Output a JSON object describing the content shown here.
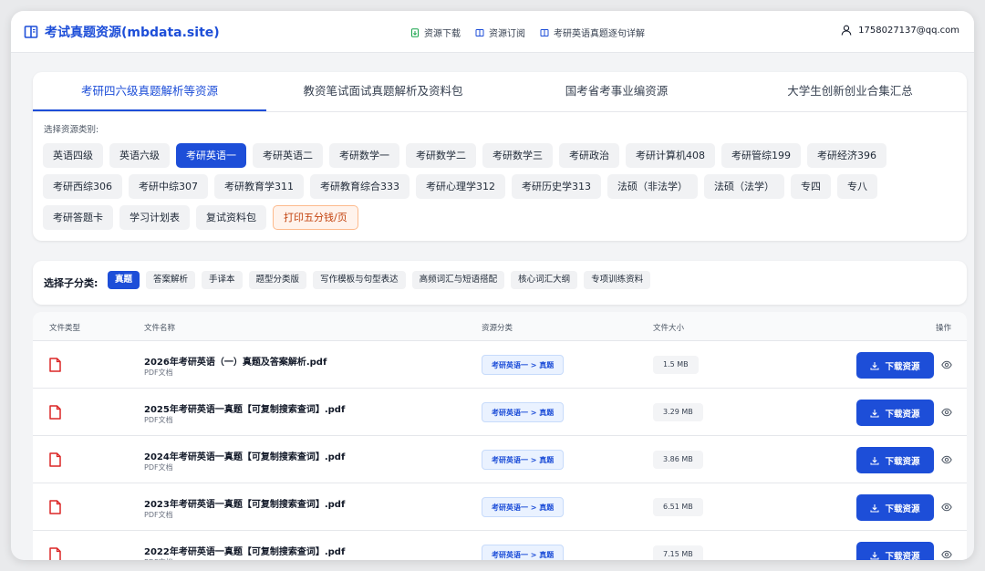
{
  "header": {
    "title": "考试真题资源(mbdata.site)",
    "nav": [
      {
        "label": "资源下载",
        "icon": "download-file-icon"
      },
      {
        "label": "资源订阅",
        "icon": "book-icon"
      },
      {
        "label": "考研英语真题逐句详解",
        "icon": "book-icon"
      }
    ],
    "user_email": "1758027137@qq.com"
  },
  "tabs": [
    {
      "label": "考研四六级真题解析等资源",
      "active": true
    },
    {
      "label": "教资笔试面试真题解析及资料包",
      "active": false
    },
    {
      "label": "国考省考事业编资源",
      "active": false
    },
    {
      "label": "大学生创新创业合集汇总",
      "active": false
    }
  ],
  "category_label": "选择资源类别:",
  "categories": [
    "英语四级",
    "英语六级",
    "考研英语一",
    "考研英语二",
    "考研数学一",
    "考研数学二",
    "考研数学三",
    "考研政治",
    "考研计算机408",
    "考研管综199",
    "考研经济396",
    "考研西综306",
    "考研中综307",
    "考研教育学311",
    "考研教育综合333",
    "考研心理学312",
    "考研历史学313",
    "法硕（非法学）",
    "法硕（法学）",
    "专四",
    "专八",
    "考研答题卡",
    "学习计划表",
    "复试资料包",
    "打印五分钱/页"
  ],
  "active_category": "考研英语一",
  "promo_category": "打印五分钱/页",
  "subcategory_label": "选择子分类:",
  "subcategories": [
    "真题",
    "答案解析",
    "手译本",
    "题型分类版",
    "写作模板与句型表达",
    "高频词汇与短语搭配",
    "核心词汇大纲",
    "专项训练资料"
  ],
  "active_subcategory": "真题",
  "table": {
    "headers": {
      "type": "文件类型",
      "name": "文件名称",
      "category": "资源分类",
      "size": "文件大小",
      "action": "操作"
    },
    "download_label": "下载资源",
    "rows": [
      {
        "name": "2026年考研英语（一）真题及答案解析.pdf",
        "type": "PDF文档",
        "category": "考研英语一 > 真题",
        "size": "1.5 MB"
      },
      {
        "name": "2025年考研英语一真题【可复制搜索查词】.pdf",
        "type": "PDF文档",
        "category": "考研英语一 > 真题",
        "size": "3.29 MB"
      },
      {
        "name": "2024年考研英语一真题【可复制搜索查词】.pdf",
        "type": "PDF文档",
        "category": "考研英语一 > 真题",
        "size": "3.86 MB"
      },
      {
        "name": "2023年考研英语一真题【可复制搜索查词】.pdf",
        "type": "PDF文档",
        "category": "考研英语一 > 真题",
        "size": "6.51 MB"
      },
      {
        "name": "2022年考研英语一真题【可复制搜索查词】.pdf",
        "type": "PDF文档",
        "category": "考研英语一 > 真题",
        "size": "7.15 MB"
      }
    ]
  },
  "colors": {
    "accent": "#1d4ed8",
    "pdf_icon": "#dc2626",
    "promo": "#c2410c"
  }
}
